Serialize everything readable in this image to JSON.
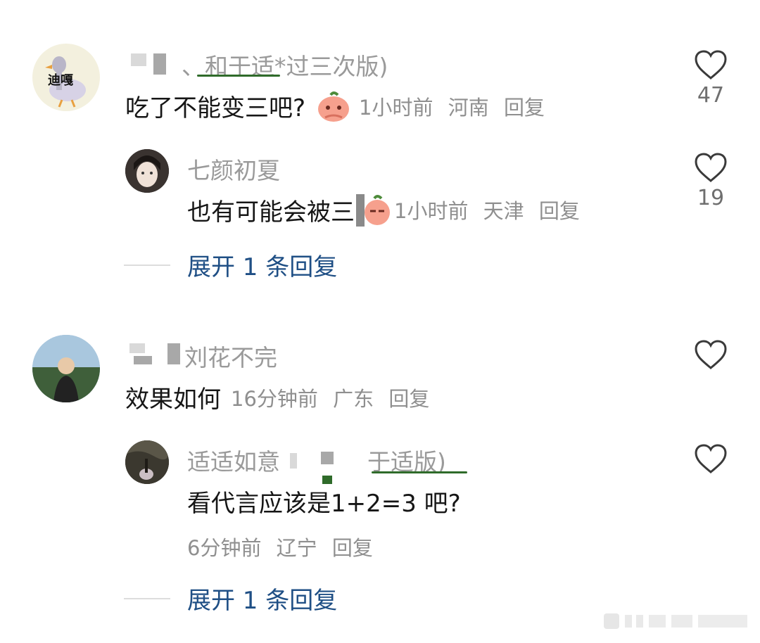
{
  "comments": [
    {
      "username_visible": "、和于适*过三次版)",
      "avatar_label": "迪嘎",
      "text": "吃了不能变三吧?",
      "time": "1小时前",
      "location": "河南",
      "reply_label": "回复",
      "likes": "47",
      "replies": [
        {
          "username": "七颜初夏",
          "text": "也有可能会被三",
          "time": "1小时前",
          "location": "天津",
          "reply_label": "回复",
          "likes": "19"
        }
      ],
      "expand_label": "展开 1 条回复"
    },
    {
      "username_visible": "刘花不完",
      "text": "效果如何",
      "time": "16分钟前",
      "location": "广东",
      "reply_label": "回复",
      "likes": "",
      "replies": [
        {
          "username_visible_a": "适适如意",
          "username_visible_b": "于适版)",
          "text": "看代言应该是1+2=3 吧?",
          "time": "6分钟前",
          "location": "辽宁",
          "reply_label": "回复",
          "likes": ""
        }
      ],
      "expand_label": "展开 1 条回复"
    }
  ],
  "colors": {
    "username": "#9a9a9a",
    "comment_text": "#161616",
    "meta": "#8f8f8f",
    "expand_link": "#1f4f85",
    "heart_outline": "#3a3a3a"
  }
}
